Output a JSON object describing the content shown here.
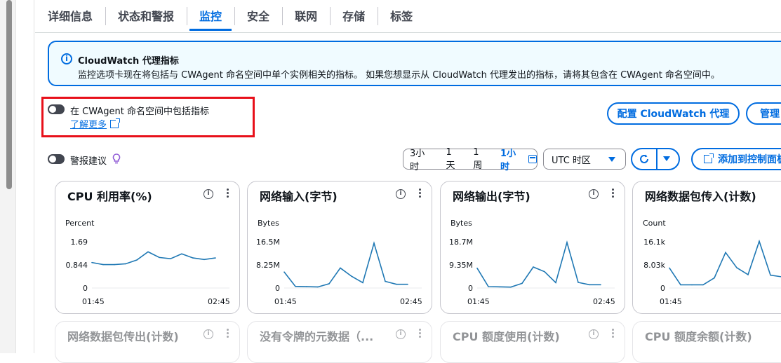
{
  "tabs": [
    {
      "label": "详细信息",
      "active": false
    },
    {
      "label": "状态和警报",
      "active": false
    },
    {
      "label": "监控",
      "active": true
    },
    {
      "label": "安全",
      "active": false
    },
    {
      "label": "联网",
      "active": false
    },
    {
      "label": "存储",
      "active": false
    },
    {
      "label": "标签",
      "active": false
    }
  ],
  "info_banner": {
    "title": "CloudWatch 代理指标",
    "body": "监控选项卡现在将包括与 CWAgent 命名空间中单个实例相关的指标。 如果您想显示从 CloudWatch 代理发出的指标，请将其包含在 CWAgent 命名空间中。"
  },
  "cwagent_toggle": {
    "label": "在 CWAgent 命名空间中包括指标",
    "learn_more": "了解更多",
    "enabled": false
  },
  "alarm_toggle": {
    "label": "警报建议",
    "enabled": false
  },
  "buttons": {
    "configure_agent": "配置 CloudWatch 代理",
    "manage": "管理",
    "add_dashboard": "添加到控制面板"
  },
  "time_range": {
    "options": [
      "3小时",
      "1天",
      "1周",
      "1小时"
    ],
    "selected": "1小时"
  },
  "timezone": "UTC 时区",
  "colors": {
    "accent": "#006ce0",
    "highlight": "#e8101a",
    "line": "#1f78b4"
  },
  "chart_data": [
    {
      "type": "line",
      "title": "CPU 利用率(%)",
      "ylabel": "Percent",
      "yticks": [
        "1.69",
        "0.844",
        "0"
      ],
      "ylim": [
        0,
        2.2
      ],
      "xticks": [
        "01:45",
        "02:45"
      ],
      "values": [
        1.0,
        0.92,
        0.92,
        0.95,
        1.1,
        1.42,
        1.2,
        1.15,
        1.34,
        1.18,
        1.12,
        1.18
      ]
    },
    {
      "type": "line",
      "title": "网络输入(字节)",
      "ylabel": "Bytes",
      "yticks": [
        "16.5M",
        "8.25M",
        "0"
      ],
      "ylim": [
        0,
        21
      ],
      "xticks": [
        "01:45",
        "02:45"
      ],
      "values": [
        6.0,
        0.6,
        0.5,
        0.4,
        1.6,
        7.5,
        4.4,
        2.0,
        16.8,
        2.5,
        1.4,
        1.4
      ]
    },
    {
      "type": "line",
      "title": "网络输出(字节)",
      "ylabel": "Bytes",
      "yticks": [
        "18.7M",
        "9.35M",
        "0"
      ],
      "ylim": [
        0,
        24
      ],
      "xticks": [
        "01:45",
        "02:45"
      ],
      "values": [
        8.5,
        0.6,
        0.5,
        0.4,
        2.0,
        9.0,
        7.0,
        2.3,
        19.5,
        2.4,
        1.4,
        1.4
      ]
    },
    {
      "type": "line",
      "title": "网络数据包传入(计数)",
      "ylabel": "Count",
      "yticks": [
        "16.1k",
        "8.03k",
        "0"
      ],
      "ylim": [
        0,
        21
      ],
      "xticks": [
        "01:45"
      ],
      "values": [
        7.5,
        1.2,
        1.2,
        1.2,
        3.8,
        13.3,
        7.6,
        5.0,
        17.5,
        4.8,
        4.2,
        4.0
      ]
    }
  ],
  "dim_cards": [
    "网络数据包传出(计数)",
    "没有令牌的元数据（...",
    "CPU 额度使用(计数)",
    "CPU 额度余额(计数)"
  ]
}
